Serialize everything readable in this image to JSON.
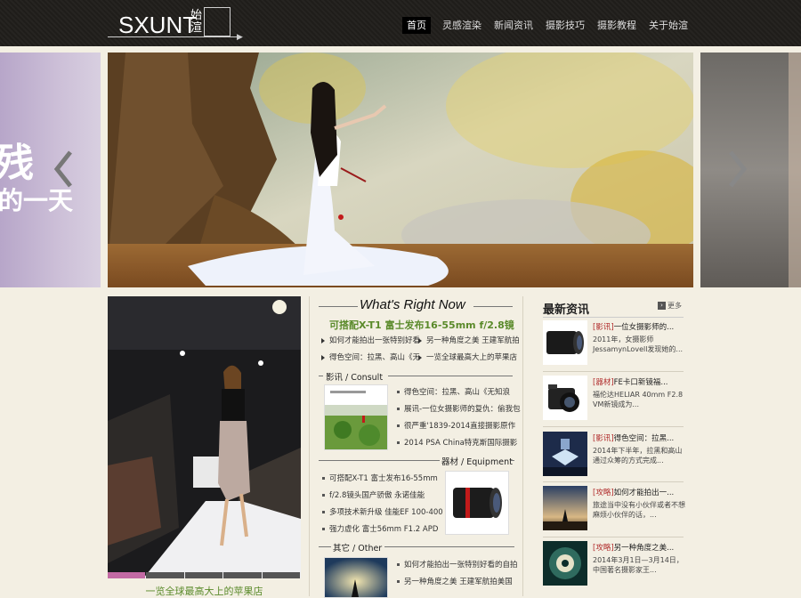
{
  "header": {
    "logo_text": "SXUNT",
    "logo_cn": "始渲",
    "nav": [
      "首页",
      "灵感渲染",
      "新闻资讯",
      "摄影技巧",
      "摄影教程",
      "关于始渲"
    ]
  },
  "banner": {
    "left_big": "残",
    "left_small": "的一天"
  },
  "left_feature": {
    "caption": "一览全球最高大上的苹果店"
  },
  "middle": {
    "title": "What's Right Now",
    "headline": "可搭配X-T1 富士发布16-55mm f/2.8镜",
    "top_links": [
      [
        "如何才能拍出一张特别好看",
        "另一种角度之美 王建军航拍"
      ],
      [
        "得色空间：拉黑、高山《无",
        "一览全球最高大上的苹果店"
      ]
    ],
    "consult": {
      "label": "影讯 / Consult",
      "items": [
        "得色空间：拉黑、高山《无知浪",
        "展讯-一位女摄影师的复仇：偷我包",
        "很严重'1839-2014直接摄影原作",
        "2014 PSA China特克斯国际摄影"
      ]
    },
    "equipment": {
      "label": "器材 / Equipment",
      "items": [
        "可搭配X-T1 富士发布16-55mm",
        "f/2.8镜头国产骄傲 永诺佳能",
        "多项技术新升级 佳能EF 100-400",
        "强力虚化 富士56mm F1.2 APD"
      ]
    },
    "other": {
      "label": "其它 / Other",
      "items": [
        "如何才能拍出一张特别好看的自拍",
        "另一种角度之美 王建军航拍美国"
      ]
    }
  },
  "news": {
    "title": "最新资讯",
    "more": "更多",
    "items": [
      {
        "tag": "[影讯]",
        "head": "一位女摄影师的...",
        "body": "2011年，女摄影师 JessamynLovell发现她的..."
      },
      {
        "tag": "[器材]",
        "head": "FE卡口新镜福...",
        "body": "福伦达HELIAR 40mm F2.8 VM新镜成为..."
      },
      {
        "tag": "[影讯]",
        "head": "得色空间：拉黑...",
        "body": "2014年下半年，拉黑和高山通过众筹的方式完成..."
      },
      {
        "tag": "[攻略]",
        "head": "如何才能拍出一...",
        "body": "旅途当中没有小伙伴或者不想麻烦小伙伴的话，..."
      },
      {
        "tag": "[攻略]",
        "head": "另一种角度之美...",
        "body": "2014年3月1日—3月14日，中国著名摄影家王..."
      }
    ]
  }
}
